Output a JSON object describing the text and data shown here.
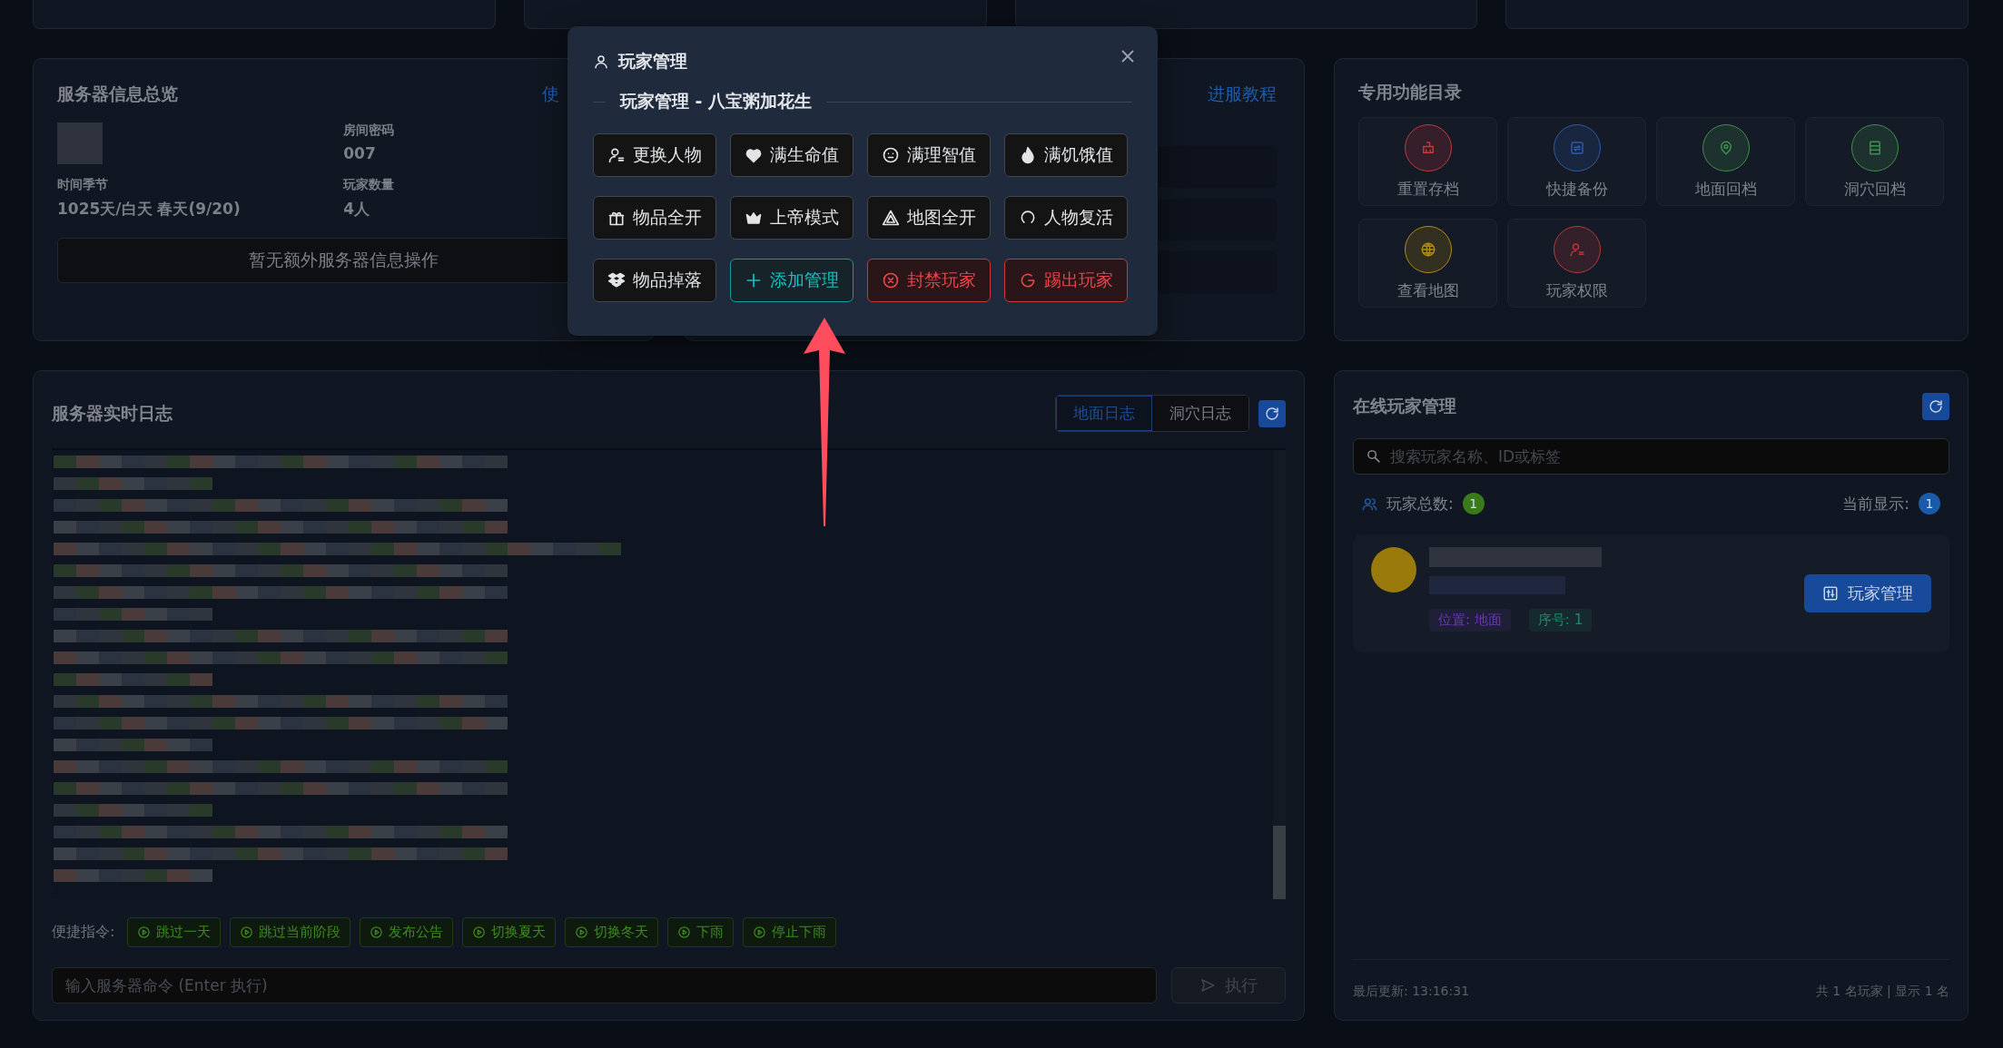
{
  "server_info": {
    "title": "服务器信息总览",
    "link": "使",
    "fields": [
      {
        "label": "房间密码",
        "value": "007"
      },
      {
        "label": "时间季节",
        "value": "1025天/白天 春天(9/20)"
      },
      {
        "label": "玩家数量",
        "value": "4人"
      }
    ],
    "action_button": "暂无额外服务器信息操作"
  },
  "join_card": {
    "link": "进服教程"
  },
  "features": {
    "title": "专用功能目录",
    "items": [
      {
        "label": "重置存档",
        "color": "#c0393b"
      },
      {
        "label": "快捷备份",
        "color": "#2f5aa8"
      },
      {
        "label": "地面回档",
        "color": "#3f8f50"
      },
      {
        "label": "洞穴回档",
        "color": "#3f8f50"
      },
      {
        "label": "查看地图",
        "color": "#b08a10"
      },
      {
        "label": "玩家权限",
        "color": "#b33a3a"
      }
    ]
  },
  "log": {
    "title": "服务器实时日志",
    "tabs": [
      {
        "label": "地面日志",
        "selected": true
      },
      {
        "label": "洞穴日志",
        "selected": false
      }
    ],
    "quick_label": "便捷指令:",
    "commands": [
      "跳过一天",
      "跳过当前阶段",
      "发布公告",
      "切换夏天",
      "切换冬天",
      "下雨",
      "停止下雨"
    ],
    "command_input": {
      "placeholder": "输入服务器命令 (Enter 执行)"
    },
    "run_button": {
      "label": "执行",
      "disabled": true
    }
  },
  "players": {
    "title": "在线玩家管理",
    "search": {
      "placeholder": "搜索玩家名称、ID或标签"
    },
    "total_label": "玩家总数:",
    "total": "1",
    "shown_label": "当前显示:",
    "shown": "1",
    "list": [
      {
        "tags": [
          {
            "text": "位置: 地面",
            "color": "#6a3bb0"
          },
          {
            "text": "序号: 1",
            "color": "#1f8a6a"
          }
        ],
        "button": "玩家管理"
      }
    ],
    "footer_left": "最后更新: 13:16:31",
    "footer_right": "共 1 名玩家 | 显示 1 名"
  },
  "modal": {
    "title": "玩家管理",
    "section_title": "玩家管理 - 八宝粥加花生",
    "actions": [
      {
        "label": "更换人物",
        "kind": "default"
      },
      {
        "label": "满生命值",
        "kind": "default"
      },
      {
        "label": "满理智值",
        "kind": "default"
      },
      {
        "label": "满饥饿值",
        "kind": "default"
      },
      {
        "label": "物品全开",
        "kind": "default"
      },
      {
        "label": "上帝模式",
        "kind": "default"
      },
      {
        "label": "地图全开",
        "kind": "default"
      },
      {
        "label": "人物复活",
        "kind": "default"
      },
      {
        "label": "物品掉落",
        "kind": "default"
      },
      {
        "label": "添加管理",
        "kind": "primary"
      },
      {
        "label": "封禁玩家",
        "kind": "danger"
      },
      {
        "label": "踢出玩家",
        "kind": "danger"
      }
    ]
  }
}
